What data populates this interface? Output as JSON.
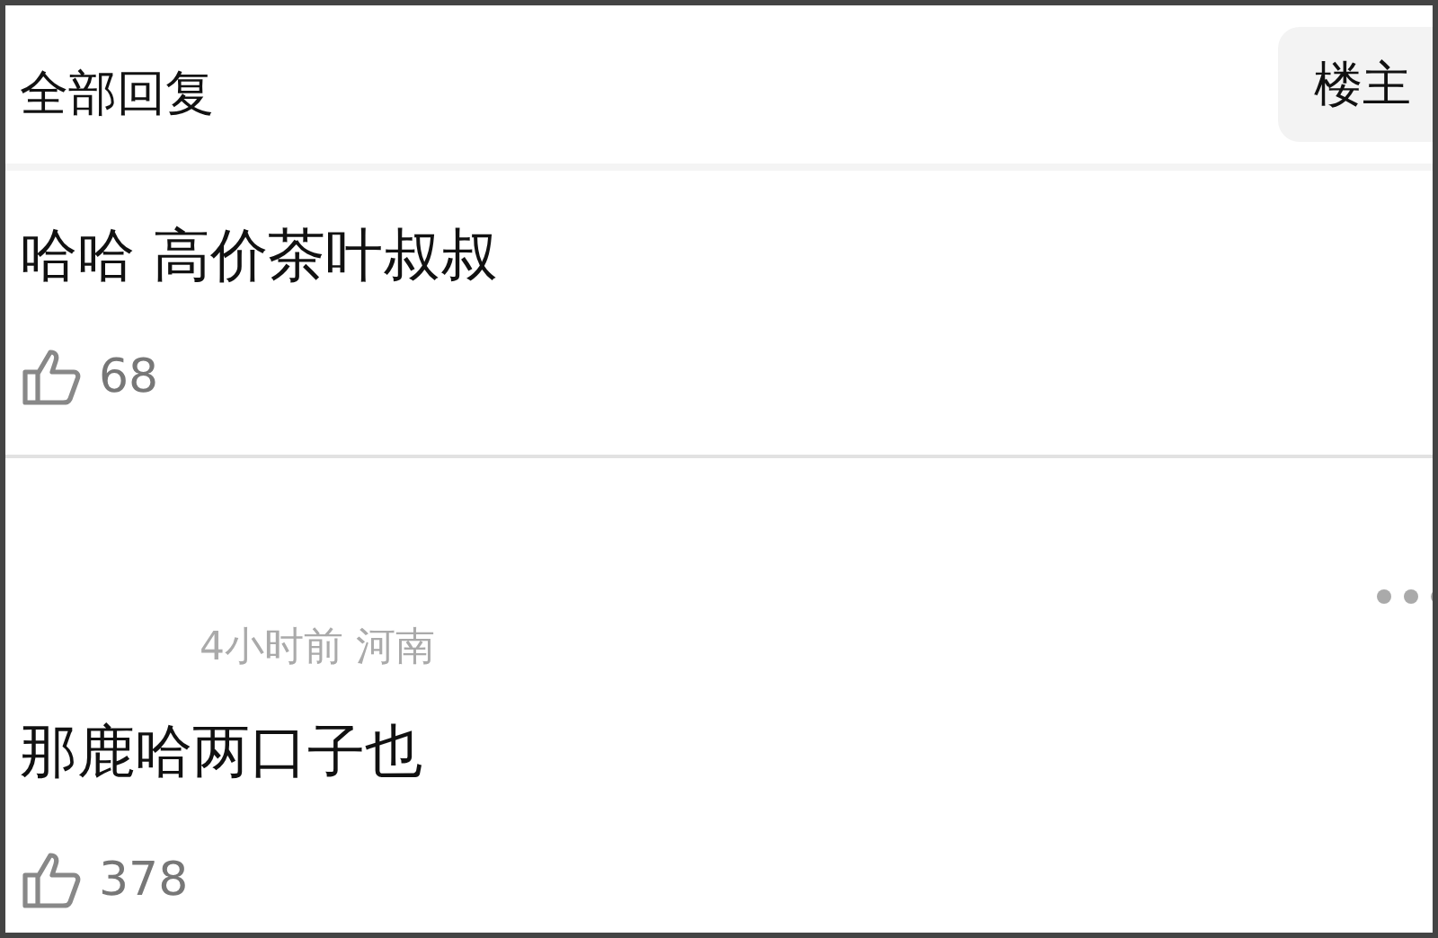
{
  "header": {
    "title": "全部回复",
    "filter_button": "楼主"
  },
  "comments": [
    {
      "text": "哈哈 高价茶叶叔叔",
      "likes": "68"
    },
    {
      "meta": "4小时前 河南",
      "text": "那鹿哈两口子也",
      "likes": "378",
      "has_menu": true
    }
  ]
}
